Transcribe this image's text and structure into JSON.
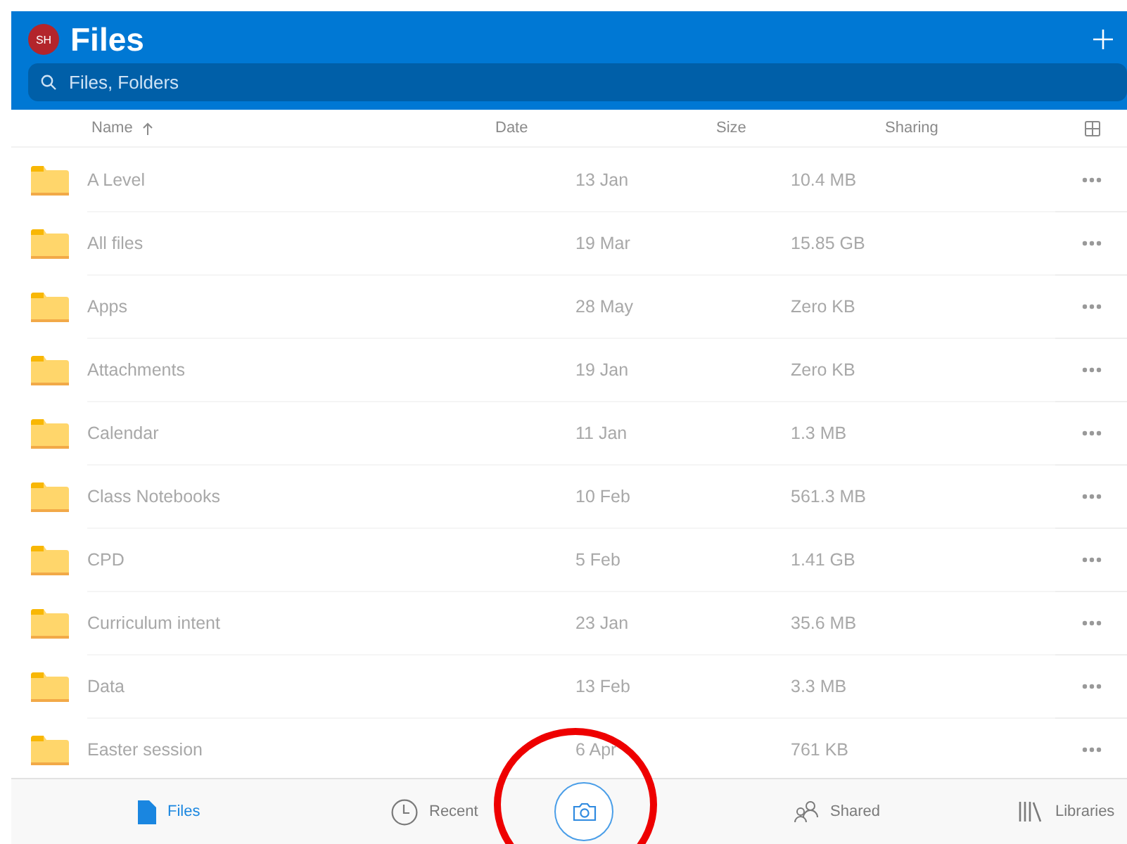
{
  "header": {
    "avatar_initials": "SH",
    "title": "Files"
  },
  "search": {
    "placeholder": "Files, Folders"
  },
  "table": {
    "columns": [
      "Name",
      "Date",
      "Size",
      "Sharing"
    ],
    "rows": [
      {
        "name": "A Level",
        "date": "13 Jan",
        "size": "10.4 MB"
      },
      {
        "name": "All files",
        "date": "19 Mar",
        "size": "15.85 GB"
      },
      {
        "name": "Apps",
        "date": "28 May",
        "size": "Zero KB"
      },
      {
        "name": "Attachments",
        "date": "19 Jan",
        "size": "Zero KB"
      },
      {
        "name": "Calendar",
        "date": "11 Jan",
        "size": "1.3 MB"
      },
      {
        "name": "Class Notebooks",
        "date": "10 Feb",
        "size": "561.3 MB"
      },
      {
        "name": "CPD",
        "date": "5 Feb",
        "size": "1.41 GB"
      },
      {
        "name": "Curriculum intent",
        "date": "23 Jan",
        "size": "35.6 MB"
      },
      {
        "name": "Data",
        "date": "13 Feb",
        "size": "3.3 MB"
      },
      {
        "name": "Easter session",
        "date": "6 Apr",
        "size": "761 KB"
      }
    ]
  },
  "tab_bar": {
    "tabs": [
      {
        "label": "Files",
        "kind": "files",
        "selected": true
      },
      {
        "label": "Recent",
        "kind": "recent",
        "selected": false
      },
      {
        "kind": "camera"
      },
      {
        "label": "Shared",
        "kind": "shared",
        "selected": false
      },
      {
        "label": "Libraries",
        "kind": "libraries",
        "selected": false
      }
    ]
  },
  "annotation": {
    "kind": "ellipse"
  }
}
